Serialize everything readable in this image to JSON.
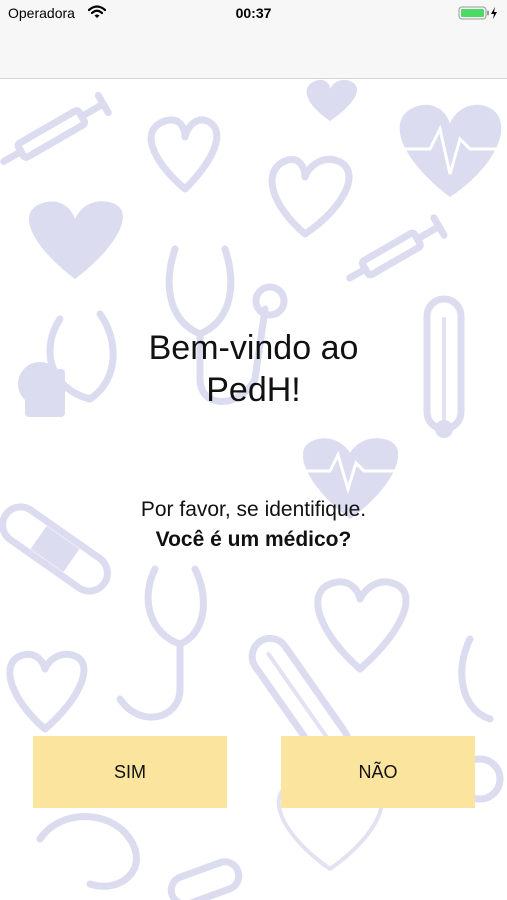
{
  "status_bar": {
    "carrier": "Operadora",
    "time": "00:37"
  },
  "welcome": {
    "title_line1": "Bem-vindo ao",
    "title_line2": "PedH!"
  },
  "identify": {
    "prompt": "Por favor, se identifique.",
    "question": "Você é um médico?"
  },
  "buttons": {
    "yes_label": "SIM",
    "no_label": "NÃO"
  },
  "colors": {
    "button_bg": "#fbe49d",
    "pattern": "#dcdcf0",
    "battery": "#4cd964"
  },
  "icons": [
    "wifi-icon",
    "battery-icon",
    "charging-bolt-icon"
  ]
}
